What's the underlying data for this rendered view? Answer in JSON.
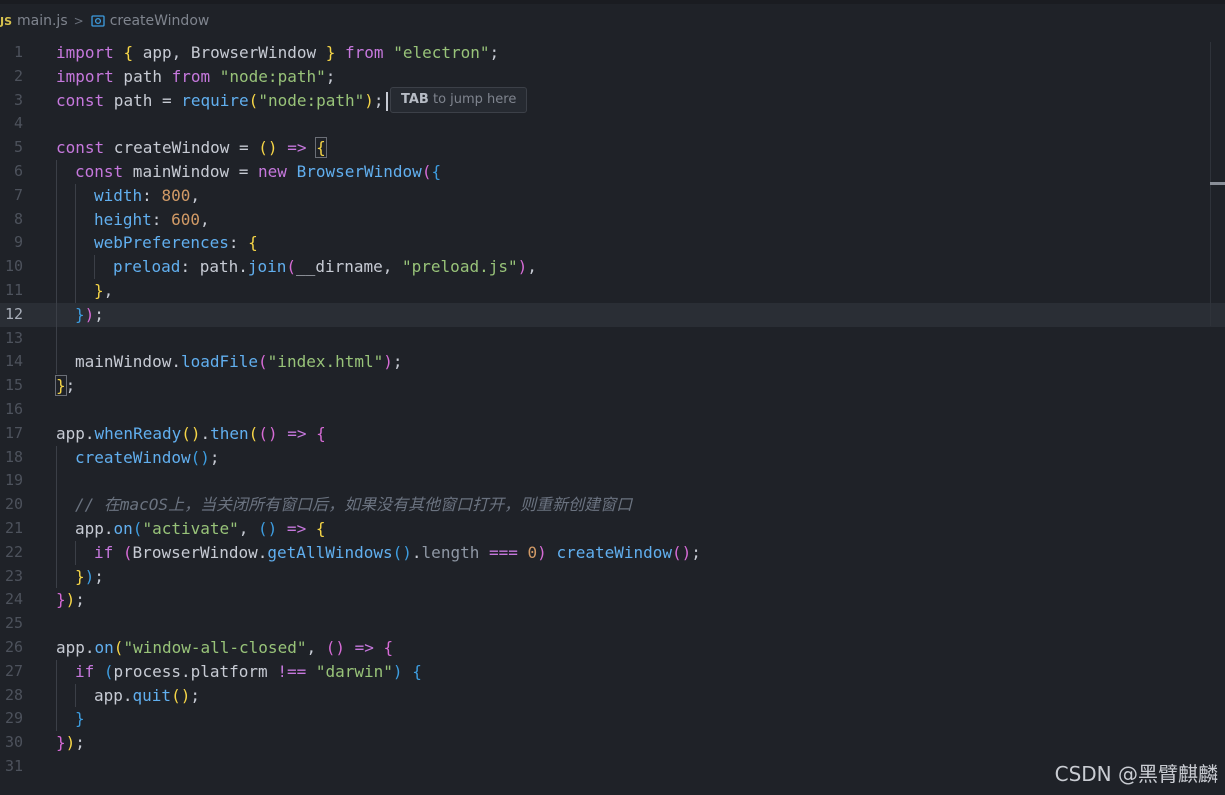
{
  "breadcrumb": {
    "file_type_label": "JS",
    "file_name": "main.js",
    "separator": ">",
    "symbol": "createWindow"
  },
  "hint": {
    "key": "TAB",
    "text": "to jump here"
  },
  "watermark": "CSDN @黑臂麒麟",
  "current_line": 12,
  "lines": [
    {
      "n": "1"
    },
    {
      "n": "2"
    },
    {
      "n": "3"
    },
    {
      "n": "4"
    },
    {
      "n": "5"
    },
    {
      "n": "6"
    },
    {
      "n": "7"
    },
    {
      "n": "8"
    },
    {
      "n": "9"
    },
    {
      "n": "10"
    },
    {
      "n": "11"
    },
    {
      "n": "12"
    },
    {
      "n": "13"
    },
    {
      "n": "14"
    },
    {
      "n": "15"
    },
    {
      "n": "16"
    },
    {
      "n": "17"
    },
    {
      "n": "18"
    },
    {
      "n": "19"
    },
    {
      "n": "20"
    },
    {
      "n": "21"
    },
    {
      "n": "22"
    },
    {
      "n": "23"
    },
    {
      "n": "24"
    },
    {
      "n": "25"
    },
    {
      "n": "26"
    },
    {
      "n": "27"
    },
    {
      "n": "28"
    },
    {
      "n": "29"
    },
    {
      "n": "30"
    },
    {
      "n": "31"
    }
  ],
  "code": {
    "l1": [
      "import",
      " ",
      "{",
      " app, BrowserWindow ",
      "}",
      " ",
      "from",
      " ",
      "\"electron\"",
      ";"
    ],
    "l2": [
      "import",
      " path ",
      "from",
      " ",
      "\"node:path\"",
      ";"
    ],
    "l3": [
      "const",
      " path = ",
      "require",
      "(",
      "\"node:path\"",
      ")",
      ";"
    ],
    "l5": [
      "const",
      " createWindow = ",
      "()",
      " => ",
      "{"
    ],
    "l6": [
      "const",
      " mainWindow = ",
      "new",
      " ",
      "BrowserWindow",
      "(",
      "{"
    ],
    "l7": [
      "width",
      ": ",
      "800",
      ","
    ],
    "l8": [
      "height",
      ": ",
      "600",
      ","
    ],
    "l9": [
      "webPreferences",
      ": ",
      "{"
    ],
    "l10": [
      "preload",
      ": path.",
      "join",
      "(",
      "__dirname, ",
      "\"preload.js\"",
      ")",
      ","
    ],
    "l11": [
      "}",
      ","
    ],
    "l12": [
      "}",
      ")",
      ";"
    ],
    "l14": [
      "mainWindow.",
      "loadFile",
      "(",
      "\"index.html\"",
      ")",
      ";"
    ],
    "l15": [
      "}",
      ";"
    ],
    "l17": [
      "app.",
      "whenReady",
      "()",
      ".",
      "then",
      "(",
      "(",
      ")",
      " => ",
      "{"
    ],
    "l18": [
      "createWindow",
      "()",
      ";"
    ],
    "l20": [
      "// 在macOS上，当关闭所有窗口后，如果没有其他窗口打开，则重新创建窗口"
    ],
    "l21": [
      "app.",
      "on",
      "(",
      "\"activate\"",
      ", ",
      "()",
      " => ",
      "{"
    ],
    "l22": [
      "if",
      " ",
      "(",
      "BrowserWindow.",
      "getAllWindows",
      "()",
      ".",
      "length",
      " === ",
      "0",
      ")",
      " ",
      "createWindow",
      "()",
      ";"
    ],
    "l23": [
      "}",
      ")",
      ";"
    ],
    "l24": [
      "}",
      ")",
      ";"
    ],
    "l26": [
      "app.",
      "on",
      "(",
      "\"window-all-closed\"",
      ", ",
      "()",
      " => ",
      "{"
    ],
    "l27": [
      "if",
      " ",
      "(",
      "process.platform ",
      "!==",
      " ",
      "\"darwin\"",
      ")",
      " ",
      "{"
    ],
    "l28": [
      "app.",
      "quit",
      "()",
      ";"
    ],
    "l29": [
      "}"
    ],
    "l30": [
      "}",
      ")",
      ";"
    ]
  },
  "colors": {
    "background": "#1f2228",
    "keyword": "#c678dd",
    "string": "#98c379",
    "number": "#d19a66",
    "function": "#61afef",
    "property": "#e5c07b",
    "comment": "#6b7380"
  }
}
